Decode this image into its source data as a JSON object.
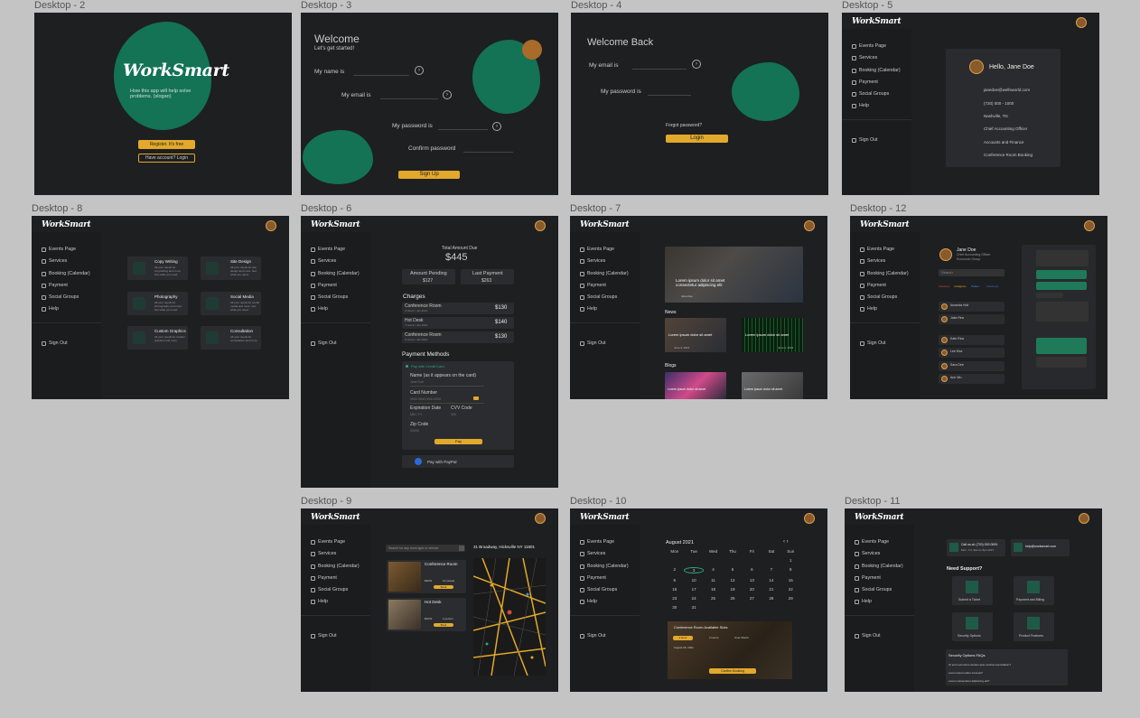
{
  "frames": {
    "d2": {
      "label": "Desktop - 2",
      "logo": "WorkSmart",
      "tagline": "How this app will help solve problems. (slogan)",
      "register": "Register. It's free",
      "login": "Have account? Login"
    },
    "d3": {
      "label": "Desktop - 3",
      "title": "Welcome",
      "subtitle": "Let's get started!",
      "name": "My name is",
      "email": "My email is",
      "password": "My password is",
      "confirm": "Confirm password",
      "signup": "Sign Up"
    },
    "d4": {
      "label": "Desktop - 4",
      "title": "Welcome Back",
      "email": "My email is",
      "password": "My password is",
      "forgot": "Forgot password?",
      "login": "Login"
    },
    "d5": {
      "label": "Desktop - 5",
      "hello": "Hello, Jane Doe",
      "info": [
        "janedoe@wellsworld.com",
        "(720) 000 - 1000",
        "Nashville, TN",
        "Chief Accounting Officer",
        "Accounts and Finance",
        "Conference Room Booking"
      ]
    },
    "d8": {
      "label": "Desktop - 8",
      "services": [
        {
          "title": "Copy Writing",
          "desc": "All your needs for copywriting and more. Get what you need."
        },
        {
          "title": "Site Design",
          "desc": "All your needs for site design and more. Get what you need."
        },
        {
          "title": "Photography",
          "desc": "All your needs for photography and more. Get what you need."
        },
        {
          "title": "Social Media",
          "desc": "All your needs for social media and more. Get what you need."
        },
        {
          "title": "Custom Graphics",
          "desc": "All your needs for custom graphics and more."
        },
        {
          "title": "Consultation",
          "desc": "All your needs for consultation and more."
        }
      ]
    },
    "d6": {
      "label": "Desktop - 6",
      "total_label": "Total Amount Due",
      "total": "$445",
      "pending_label": "Amount Pending",
      "pending": "$127",
      "last_label": "Last Payment",
      "last": "$263",
      "charges_title": "Charges",
      "charges": [
        {
          "name": "Conference Room",
          "sub": "2 Hours / Jan 2021",
          "amount": "$130"
        },
        {
          "name": "Hot Desk",
          "sub": "7 Hours / Jan 2021",
          "amount": "$140"
        },
        {
          "name": "Conference Room",
          "sub": "2 Hours / Jan 2021",
          "amount": "$130"
        }
      ],
      "methods_title": "Payment Methods",
      "credit": "Pay with Credit Card",
      "card_name": "Name (as it appears on the card)",
      "card_name_ph": "Jane Doe",
      "card_number": "Card Number",
      "card_number_ph": "0000 0000 0000 0000",
      "exp": "Expiration Date",
      "exp_ph": "MM / YY",
      "cvv": "CVV Code",
      "cvv_ph": "000",
      "zip": "Zip Code",
      "zip_ph": "00000",
      "pay": "Pay",
      "paypal": "Pay with PayPal"
    },
    "d7": {
      "label": "Desktop - 7",
      "hero": "Lorem ipsum dolor sit amet consectetur adipiscing elit",
      "hero_by": "Jane Doe",
      "news_title": "News",
      "news": [
        {
          "title": "Lorem ipsum dolor sit amet",
          "date": "June 4, 2021"
        },
        {
          "title": "Lorem ipsum dolor sit amet",
          "date": "June 4, 2021"
        }
      ],
      "blogs_title": "Blogs",
      "blogs": [
        "Lorem ipsum dolor sit amet",
        "Lorem ipsum dolor sit amet"
      ]
    },
    "d12": {
      "label": "Desktop - 12",
      "name": "Jane Doe",
      "role": "Chief Accounting Officer",
      "group": "Economic Group",
      "search": "Search",
      "tabs": [
        "Favorites",
        "Instagram",
        "Twitter",
        "Facebook"
      ],
      "contacts": [
        "Amanda Holt",
        "Jake Rea",
        "Kate Rios",
        "Lee Mox",
        "Sara Dee",
        "Ann Wu"
      ]
    },
    "d9": {
      "label": "Desktop - 9",
      "search": "Search for any room type or service",
      "address": "31 Broadway, Hicksville NY 11801",
      "rooms": [
        {
          "title": "Conference Room",
          "price": "$30/hr",
          "cap": "12 people",
          "button": "Book"
        },
        {
          "title": "Hot Desk",
          "price": "$10/hr",
          "cap": "1 person",
          "button": "Book"
        }
      ]
    },
    "d10": {
      "label": "Desktop - 10",
      "month": "August 2021",
      "days": [
        "Mon",
        "Tue",
        "Wed",
        "Thu",
        "Fri",
        "Sat",
        "Sun"
      ],
      "dates": [
        "",
        "",
        "",
        "",
        "",
        "",
        "1",
        "2",
        "3",
        "4",
        "5",
        "6",
        "7",
        "8",
        "9",
        "10",
        "11",
        "12",
        "13",
        "14",
        "15",
        "16",
        "17",
        "18",
        "19",
        "20",
        "21",
        "22",
        "23",
        "24",
        "25",
        "26",
        "27",
        "28",
        "29",
        "30",
        "31"
      ],
      "selected": "3",
      "booking_title": "Conference Room Available Slots",
      "slots": [
        "1 Hour",
        "2 Hours",
        "Over Month"
      ],
      "booking_date": "August 26, 2021",
      "confirm": "Confirm Booking"
    },
    "d11": {
      "label": "Desktop - 11",
      "call": "Call us at: (720) 000 0000",
      "call_sub": "Mon - Fri, 9am to 5pm EST",
      "email": "help@worksmart.com",
      "support_title": "Need Support?",
      "tiles": [
        "Submit a Ticket",
        "Payment and Billing",
        "Security Options",
        "Product Features"
      ],
      "faq_title": "Security Options FAQs",
      "faqs": [
        "Ut enim ad minim veniam quis nostrud exercitation?",
        "Lorem ipsum dolor sit amet?",
        "Lorem consectetur adipiscing elit?"
      ]
    }
  },
  "sidebar": {
    "logo": "WorkSmart",
    "items": [
      "Events Page",
      "Services",
      "Booking (Calendar)",
      "Payment",
      "Social Groups",
      "Help"
    ],
    "signout": "Sign Out"
  },
  "colors": {
    "bg": "#1e1f21",
    "accent": "#e2a92b",
    "green": "#137354",
    "teal": "#2aa884"
  }
}
